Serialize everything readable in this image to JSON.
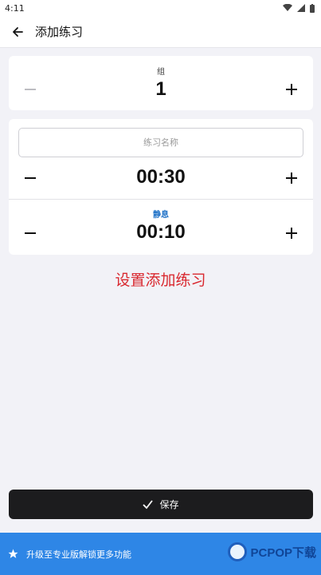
{
  "status_bar": {
    "time": "4:11"
  },
  "header": {
    "title": "添加练习"
  },
  "sets": {
    "label": "组",
    "value": "1"
  },
  "exercise": {
    "name_placeholder": "练习名称",
    "work_time": "00:30",
    "rest_label": "静息",
    "rest_time": "00:10"
  },
  "promo_text": "设置添加练习",
  "save_button": {
    "label": "保存"
  },
  "upgrade_banner": {
    "text": "升级至专业版解锁更多功能"
  },
  "watermark": {
    "text": "PCPOP下载"
  },
  "colors": {
    "background": "#f2f2f7",
    "accent_blue": "#2e86e6",
    "rest_label": "#1b6fc6",
    "promo_red": "#d9282f",
    "save_button": "#1c1c1e"
  }
}
